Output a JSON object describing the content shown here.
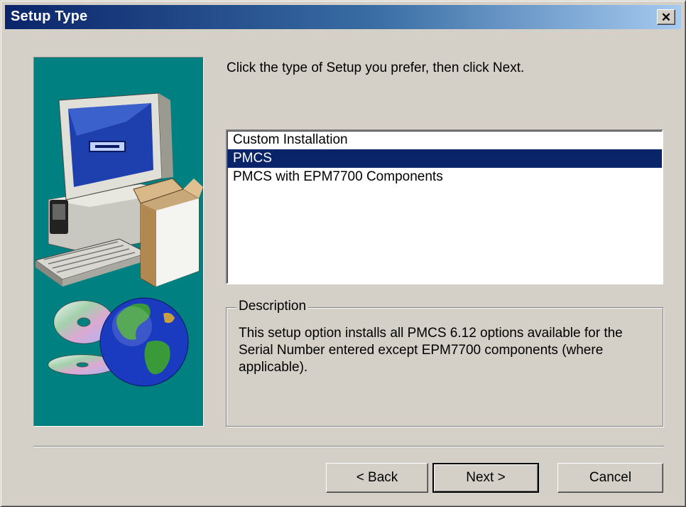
{
  "window": {
    "title": "Setup Type",
    "close_glyph": "✕",
    "accent": "#0a246a"
  },
  "illustration": {
    "background": "#008080",
    "icons": [
      "computer-icon",
      "box-icon",
      "cd-icon",
      "globe-icon"
    ]
  },
  "prompt": "Click the type of Setup you prefer, then click Next.",
  "setup_list": {
    "items": [
      "Custom Installation",
      "PMCS",
      "PMCS with EPM7700 Components"
    ],
    "selected": "PMCS",
    "selection_color": "#0a246a"
  },
  "description": {
    "legend": "Description",
    "text": "This setup option installs all PMCS 6.12  options available for the Serial Number entered except EPM7700 components (where applicable)."
  },
  "buttons": {
    "back": "< Back",
    "next": "Next >",
    "cancel": "Cancel"
  }
}
